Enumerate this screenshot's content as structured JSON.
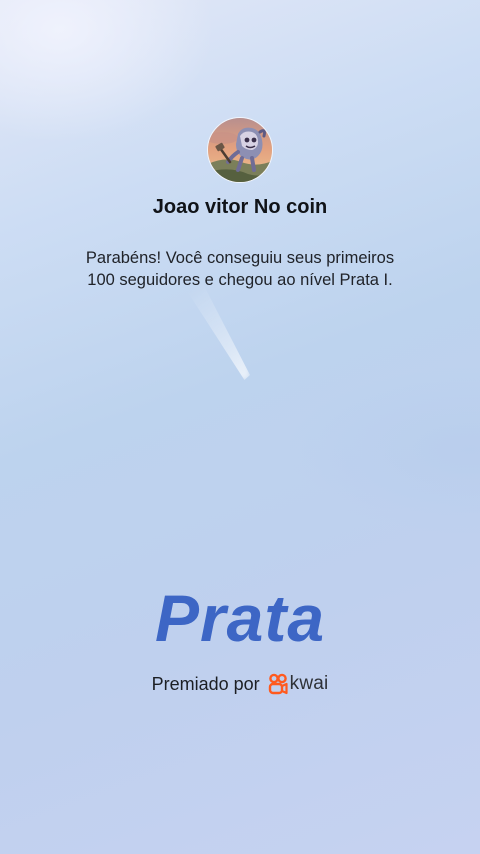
{
  "profile": {
    "username": "Joao vitor No coin",
    "avatar_icon": "game-character-avatar"
  },
  "message": {
    "line1": "Parabéns! Você conseguiu seus primeiros",
    "line2": "100 seguidores e chegou ao nível Prata I."
  },
  "level": {
    "name": "Prata",
    "color": "#3d66c5"
  },
  "award": {
    "label": "Premiado por",
    "brand_name": "kwai",
    "brand_icon": "kwai-logo-icon",
    "brand_color": "#ff5a1f"
  }
}
